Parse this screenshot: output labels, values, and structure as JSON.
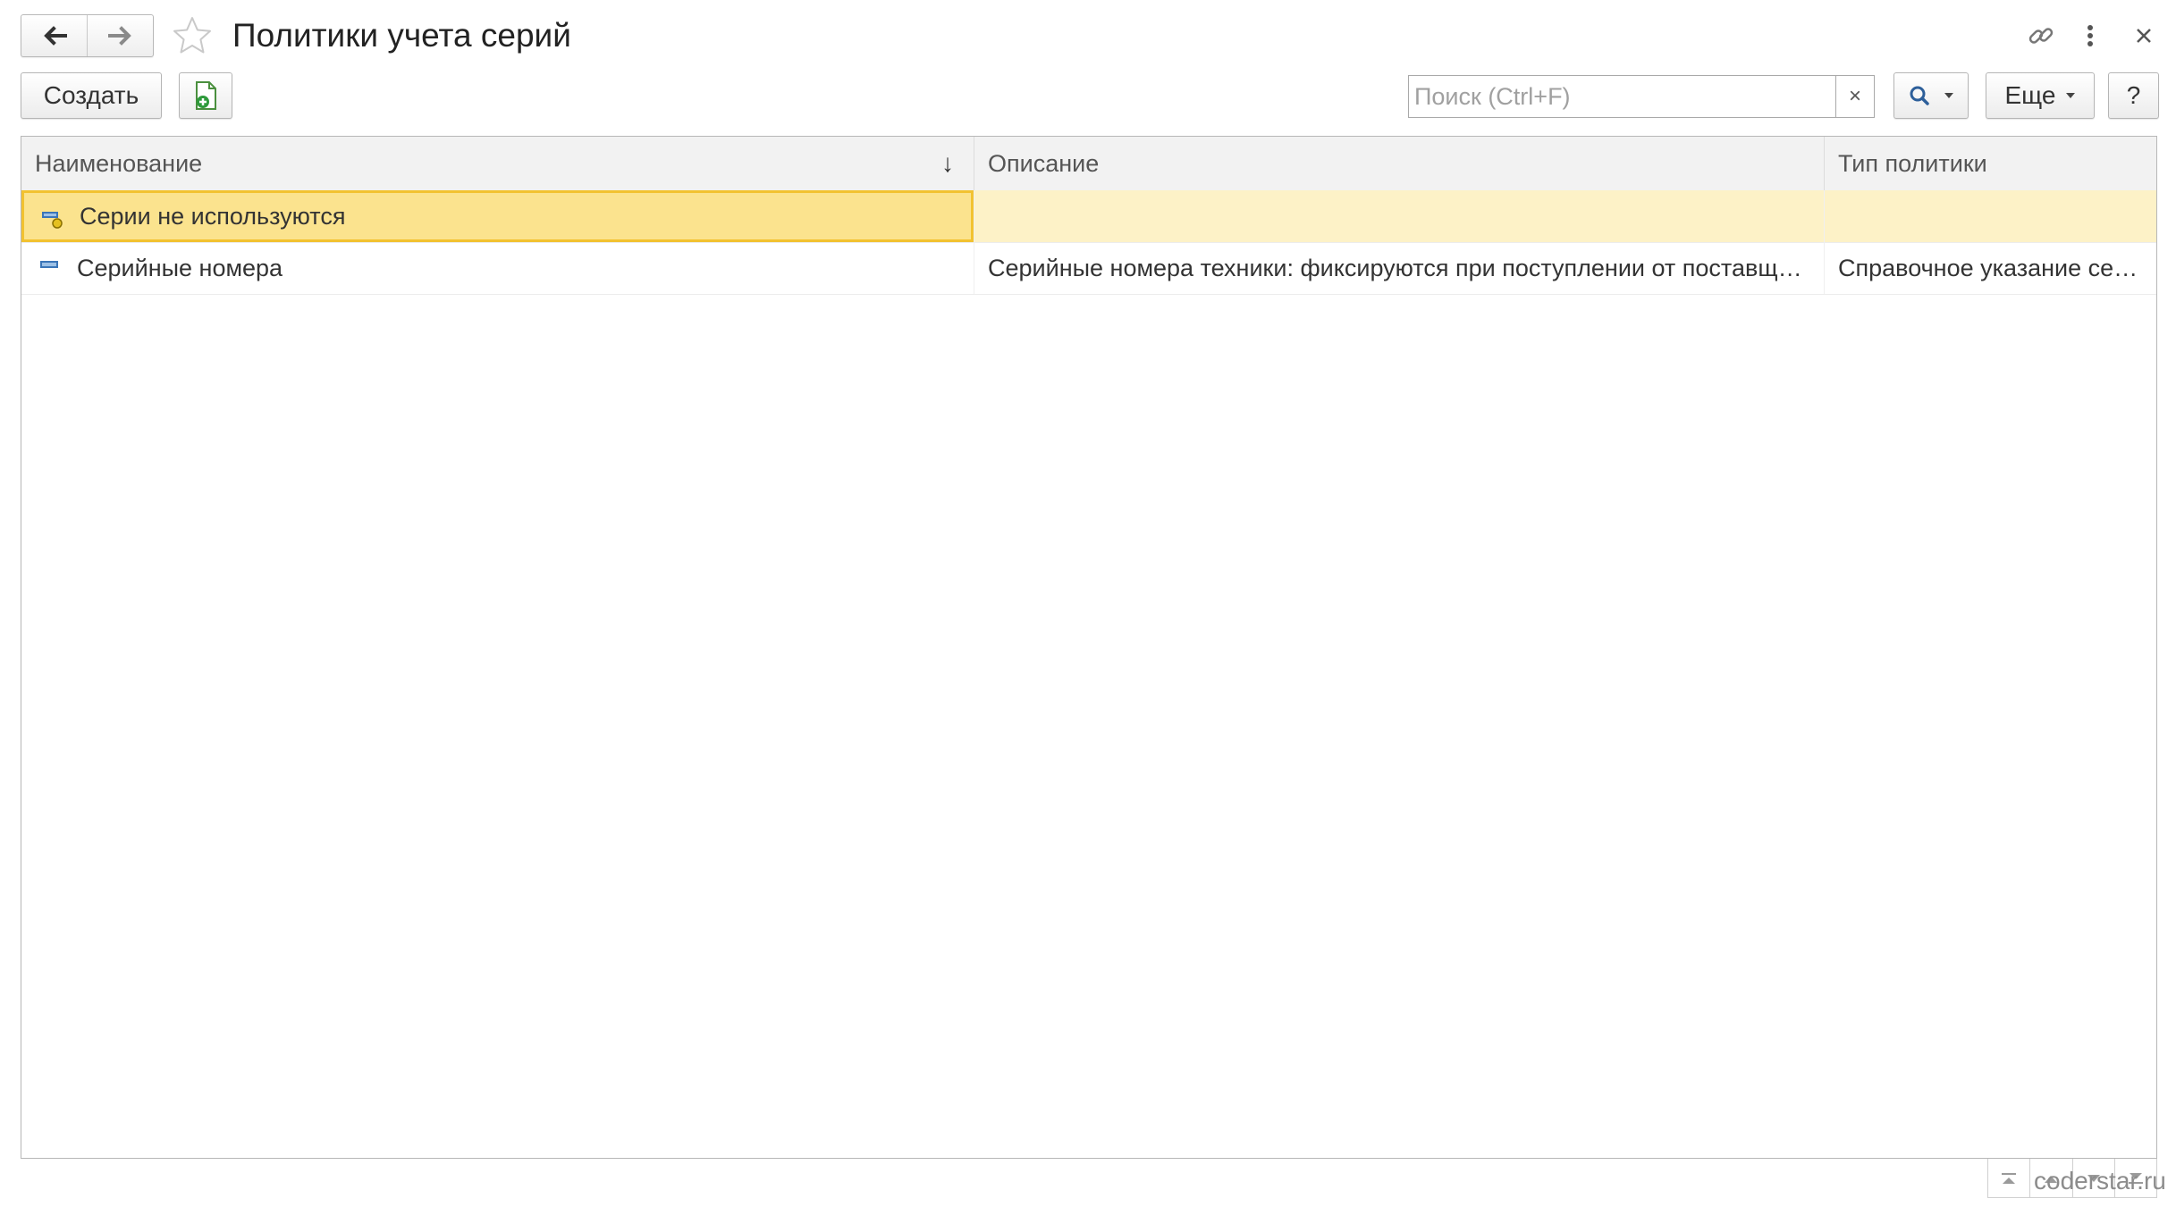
{
  "header": {
    "title": "Политики учета серий",
    "back_icon": "arrow-left-icon",
    "forward_icon": "arrow-right-icon",
    "favorite_icon": "star-icon",
    "link_icon": "link-icon",
    "more_icon": "vertical-dots-icon",
    "close_icon": "close-icon"
  },
  "toolbar": {
    "create_label": "Создать",
    "create_copy_icon": "document-add-icon",
    "search": {
      "placeholder": "Поиск (Ctrl+F)",
      "value": "",
      "clear_label": "×"
    },
    "search_icon": "magnifier-icon",
    "more_label": "Еще",
    "help_label": "?"
  },
  "table": {
    "columns": [
      {
        "label": "Наименование",
        "sort": "descending"
      },
      {
        "label": "Описание"
      },
      {
        "label": "Тип политики"
      }
    ],
    "rows": [
      {
        "name": "Серии не используются",
        "description": "",
        "policy_type": "",
        "selected": true,
        "icon": "catalog-item-predefined-icon"
      },
      {
        "name": "Серийные номера",
        "description": "Серийные номера техники: фиксируются при поступлении от поставщика, отгрузке клиенту, перемещении, возврате",
        "policy_type": "Справочное указание серий",
        "selected": false,
        "icon": "catalog-item-icon"
      }
    ]
  },
  "scroll_buttons": [
    "scroll-top-icon",
    "scroll-up-icon",
    "scroll-down-icon",
    "scroll-bottom-icon"
  ],
  "watermark": "coderstar.ru",
  "colors": {
    "selection_fill": "#fbe38e",
    "selection_border": "#f2c230",
    "selected_row": "#fdf2c7",
    "header_bg": "#f2f2f2",
    "icon_blue": "#3a75b8",
    "icon_green": "#2e9a3b"
  }
}
